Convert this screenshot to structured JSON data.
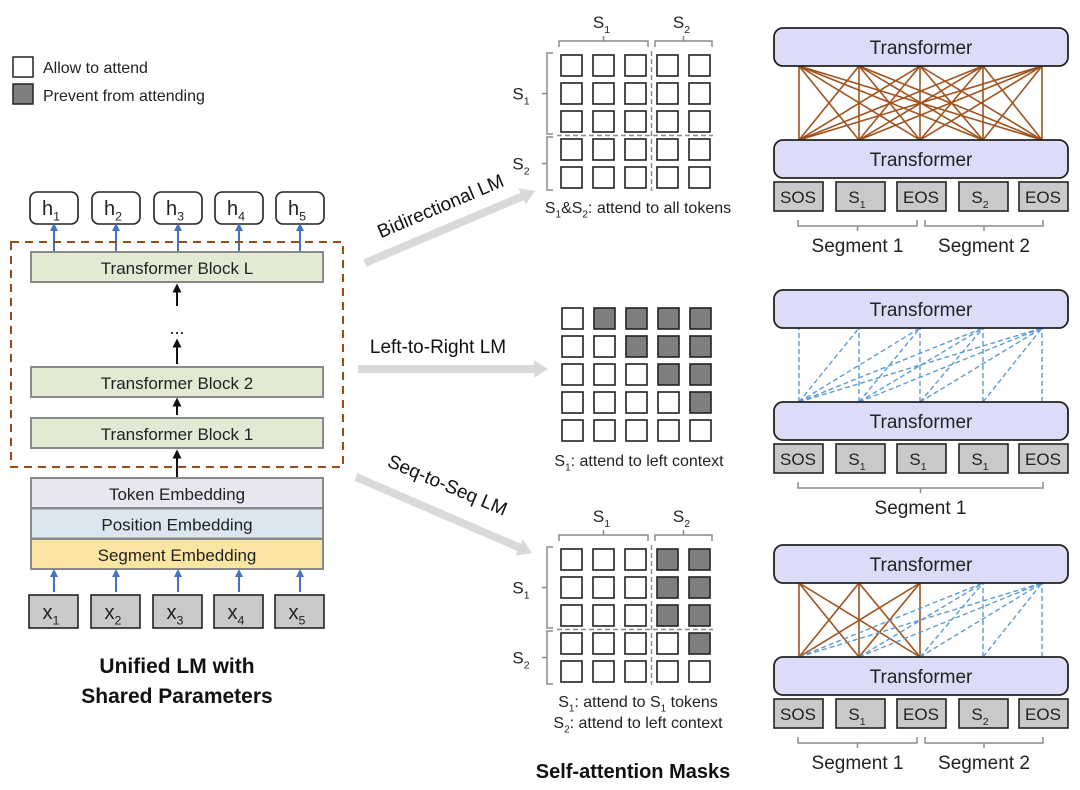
{
  "legend": {
    "items": [
      {
        "label": "Allow to attend",
        "kind": "allow"
      },
      {
        "label": "Prevent from attending",
        "kind": "prevent"
      }
    ]
  },
  "colors": {
    "allow_fill": "#ffffff",
    "prevent_fill": "#7f7f7f",
    "cell_stroke": "#222222",
    "block_fill": "#e2ead4",
    "block_stroke": "#8a8a8a",
    "token_embedding_fill": "#e8e6ef",
    "position_embedding_fill": "#dce6f1",
    "segment_embedding_fill": "#fbe5a3",
    "input_fill": "#c9c9c9",
    "dashed_frame": "#9c4a17",
    "blue_arrow": "#4472c4",
    "transformer_fill": "#dcdcf8",
    "full_attention": "#a0521d",
    "partial_attention": "#5b9bd5",
    "big_arrow": "#d9d9d9",
    "bracket": "#8c8c8c"
  },
  "left_panel": {
    "outputs": [
      {
        "base": "h",
        "sub": "1"
      },
      {
        "base": "h",
        "sub": "2"
      },
      {
        "base": "h",
        "sub": "3"
      },
      {
        "base": "h",
        "sub": "4"
      },
      {
        "base": "h",
        "sub": "5"
      }
    ],
    "blocks": [
      "Transformer Block L",
      "Transformer Block 2",
      "Transformer Block 1"
    ],
    "ellipsis": "...",
    "embeddings": [
      "Token Embedding",
      "Position Embedding",
      "Segment Embedding"
    ],
    "inputs": [
      {
        "base": "x",
        "sub": "1"
      },
      {
        "base": "x",
        "sub": "2"
      },
      {
        "base": "x",
        "sub": "3"
      },
      {
        "base": "x",
        "sub": "4"
      },
      {
        "base": "x",
        "sub": "5"
      }
    ],
    "title_line1": "Unified LM with",
    "title_line2": "Shared Parameters"
  },
  "arrows": [
    {
      "label": "Bidirectional LM"
    },
    {
      "label": "Left-to-Right LM"
    },
    {
      "label": "Seq-to-Seq LM"
    }
  ],
  "masks_title": "Self-attention Masks",
  "masks": [
    {
      "name": "bidirectional",
      "segmented": true,
      "col_labels": [
        {
          "base": "S",
          "sub": "1"
        },
        {
          "base": "S",
          "sub": "2"
        }
      ],
      "row_labels": [
        {
          "base": "S",
          "sub": "1"
        },
        {
          "base": "S",
          "sub": "2"
        }
      ],
      "grid": [
        [
          0,
          0,
          0,
          0,
          0
        ],
        [
          0,
          0,
          0,
          0,
          0
        ],
        [
          0,
          0,
          0,
          0,
          0
        ],
        [
          0,
          0,
          0,
          0,
          0
        ],
        [
          0,
          0,
          0,
          0,
          0
        ]
      ],
      "caption": [
        [
          {
            "t": "S"
          },
          {
            "sub": "1"
          },
          {
            "t": "&S"
          },
          {
            "sub": "2"
          },
          {
            "t": ": attend to all tokens"
          }
        ]
      ]
    },
    {
      "name": "left-to-right",
      "segmented": false,
      "grid": [
        [
          0,
          1,
          1,
          1,
          1
        ],
        [
          0,
          0,
          1,
          1,
          1
        ],
        [
          0,
          0,
          0,
          1,
          1
        ],
        [
          0,
          0,
          0,
          0,
          1
        ],
        [
          0,
          0,
          0,
          0,
          0
        ]
      ],
      "caption": [
        [
          {
            "t": "S"
          },
          {
            "sub": "1"
          },
          {
            "t": ": attend to left context"
          }
        ]
      ]
    },
    {
      "name": "seq-to-seq",
      "segmented": true,
      "col_labels": [
        {
          "base": "S",
          "sub": "1"
        },
        {
          "base": "S",
          "sub": "2"
        }
      ],
      "row_labels": [
        {
          "base": "S",
          "sub": "1"
        },
        {
          "base": "S",
          "sub": "2"
        }
      ],
      "grid": [
        [
          0,
          0,
          0,
          1,
          1
        ],
        [
          0,
          0,
          0,
          1,
          1
        ],
        [
          0,
          0,
          0,
          1,
          1
        ],
        [
          0,
          0,
          0,
          0,
          1
        ],
        [
          0,
          0,
          0,
          0,
          0
        ]
      ],
      "caption": [
        [
          {
            "t": "S"
          },
          {
            "sub": "1"
          },
          {
            "t": ": attend to S"
          },
          {
            "sub": "1"
          },
          {
            "t": " tokens"
          }
        ],
        [
          {
            "t": "S"
          },
          {
            "sub": "2"
          },
          {
            "t": ": attend to left context"
          }
        ]
      ]
    }
  ],
  "transformer_label": "Transformer",
  "right_panels": [
    {
      "name": "bidirectional",
      "tokens": [
        {
          "base": "SOS"
        },
        {
          "base": "S",
          "sub": "1"
        },
        {
          "base": "EOS"
        },
        {
          "base": "S",
          "sub": "2"
        },
        {
          "base": "EOS"
        }
      ],
      "segments": [
        {
          "label": "Segment 1",
          "from": 0,
          "to": 2
        },
        {
          "label": "Segment 2",
          "from": 2,
          "to": 4
        }
      ],
      "mask": [
        [
          0,
          0,
          0,
          0,
          0
        ],
        [
          0,
          0,
          0,
          0,
          0
        ],
        [
          0,
          0,
          0,
          0,
          0
        ],
        [
          0,
          0,
          0,
          0,
          0
        ],
        [
          0,
          0,
          0,
          0,
          0
        ]
      ]
    },
    {
      "name": "left-to-right",
      "tokens": [
        {
          "base": "SOS"
        },
        {
          "base": "S",
          "sub": "1"
        },
        {
          "base": "S",
          "sub": "1"
        },
        {
          "base": "S",
          "sub": "1"
        },
        {
          "base": "EOS"
        }
      ],
      "segments": [
        {
          "label": "Segment 1",
          "from": 0,
          "to": 4
        }
      ],
      "mask": [
        [
          0,
          1,
          1,
          1,
          1
        ],
        [
          0,
          0,
          1,
          1,
          1
        ],
        [
          0,
          0,
          0,
          1,
          1
        ],
        [
          0,
          0,
          0,
          0,
          1
        ],
        [
          0,
          0,
          0,
          0,
          0
        ]
      ]
    },
    {
      "name": "seq-to-seq",
      "tokens": [
        {
          "base": "SOS"
        },
        {
          "base": "S",
          "sub": "1"
        },
        {
          "base": "EOS"
        },
        {
          "base": "S",
          "sub": "2"
        },
        {
          "base": "EOS"
        }
      ],
      "segments": [
        {
          "label": "Segment 1",
          "from": 0,
          "to": 2
        },
        {
          "label": "Segment 2",
          "from": 2,
          "to": 4
        }
      ],
      "mask": [
        [
          0,
          0,
          0,
          1,
          1
        ],
        [
          0,
          0,
          0,
          1,
          1
        ],
        [
          0,
          0,
          0,
          1,
          1
        ],
        [
          0,
          0,
          0,
          0,
          1
        ],
        [
          0,
          0,
          0,
          0,
          0
        ]
      ],
      "full_block_size": 3
    }
  ]
}
